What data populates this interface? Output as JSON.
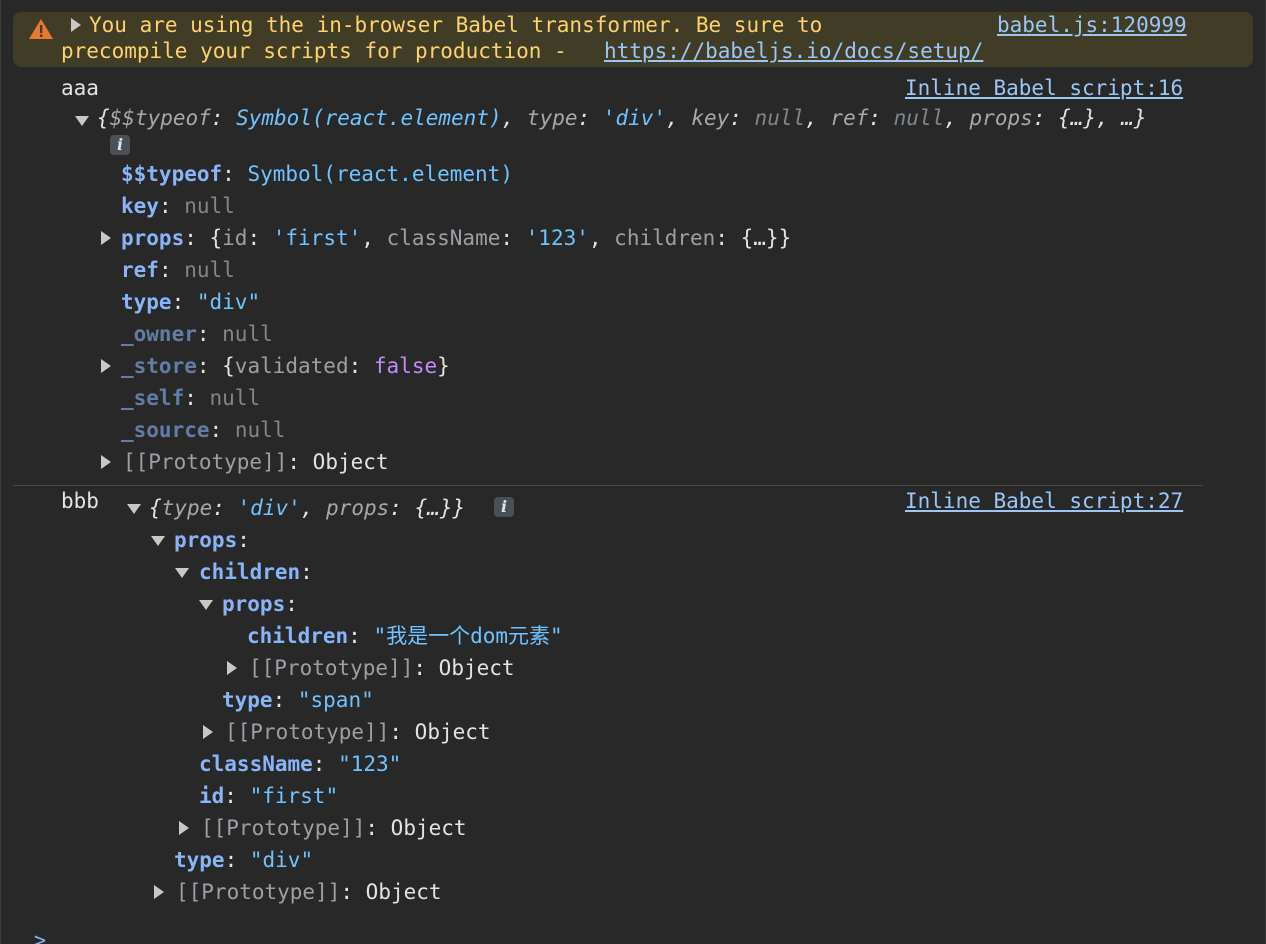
{
  "warning": {
    "line1": "You are using the in-browser Babel transformer. Be sure to",
    "line2_prefix": "precompile your scripts for production - ",
    "link": "https://babeljs.io/docs/setup/",
    "source": "babel.js:120999"
  },
  "log1": {
    "label": "aaa",
    "source": "Inline Babel script:16",
    "summary": {
      "open": "{",
      "k1": "$$typeof",
      "v1": "Symbol(react.element)",
      "k2": "type",
      "v2": "'div'",
      "k3": "key",
      "v3": "null",
      "k4": "ref",
      "v4": "null",
      "k5": "props",
      "v5": "{…}",
      "tail": ", …}"
    },
    "info_badge": "i",
    "rows": {
      "typeof_key": "$$typeof",
      "typeof_val": "Symbol(react.element)",
      "key_key": "key",
      "key_val": "null",
      "props_key": "props",
      "props_id_key": "id",
      "props_id_val": "'first'",
      "props_class_key": "className",
      "props_class_val": "'123'",
      "props_children_key": "children",
      "props_children_val": "{…}",
      "ref_key": "ref",
      "ref_val": "null",
      "type_key": "type",
      "type_val": "\"div\"",
      "owner_key": "_owner",
      "owner_val": "null",
      "store_key": "_store",
      "store_validated_key": "validated",
      "store_validated_val": "false",
      "self_key": "_self",
      "self_val": "null",
      "source_key": "_source",
      "source_val": "null",
      "proto_key": "[[Prototype]]",
      "proto_val": "Object"
    }
  },
  "log2": {
    "label": "bbb",
    "source": "Inline Babel script:27",
    "summary": {
      "k1": "type",
      "v1": "'div'",
      "k2": "props",
      "v2": "{…}"
    },
    "info_badge": "i",
    "rows": {
      "props_key": "props",
      "children_key": "children",
      "inner_props_key": "props",
      "inner_children_key": "children",
      "inner_children_val": "\"我是一个dom元素\"",
      "proto_key": "[[Prototype]]",
      "proto_val": "Object",
      "span_type_key": "type",
      "span_type_val": "\"span\"",
      "classname_key": "className",
      "classname_val": "\"123\"",
      "id_key": "id",
      "id_val": "\"first\"",
      "div_type_key": "type",
      "div_type_val": "\"div\""
    }
  },
  "prompt": ">",
  "colors": {
    "background": "#282828",
    "warning_bg": "#413c26",
    "warning_text": "#fcd36e",
    "key": "#8ab4f8",
    "string": "#6fc3ff",
    "null": "#80868b",
    "boolean": "#c58af9",
    "link": "#9bc6f5"
  }
}
